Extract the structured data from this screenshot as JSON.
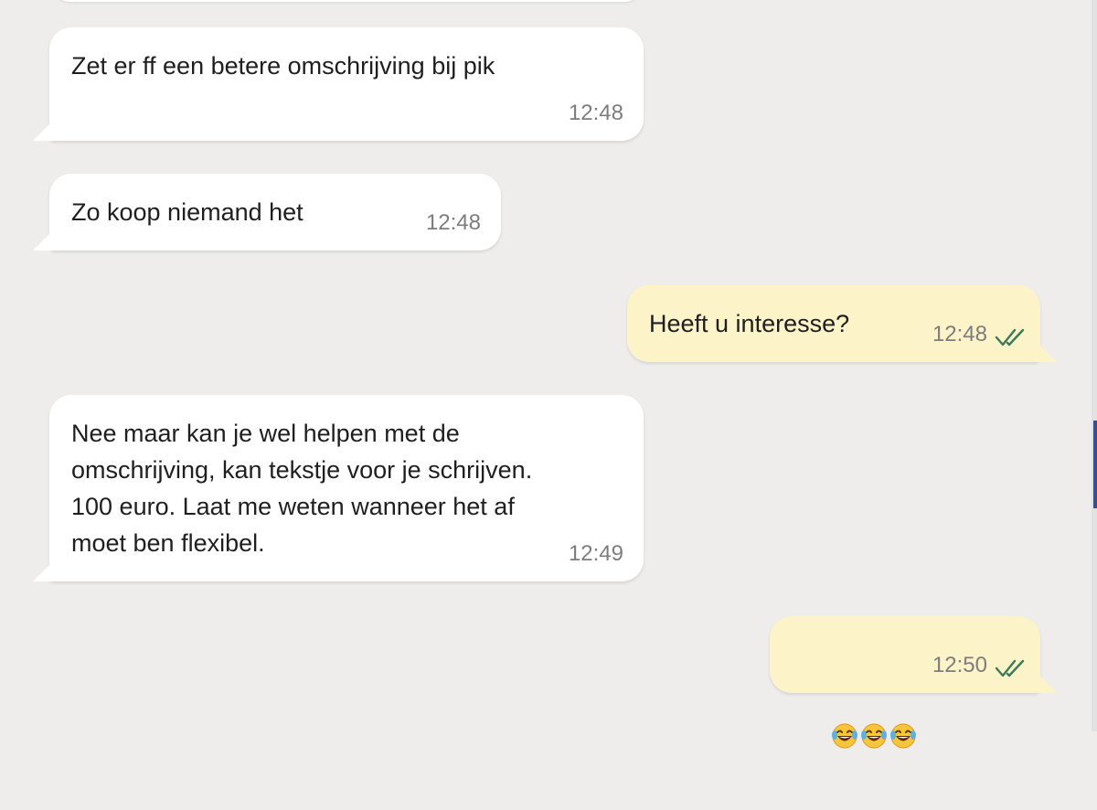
{
  "colors": {
    "background": "#eeedeb",
    "incoming_bubble": "#ffffff",
    "outgoing_bubble": "#fdf3c8",
    "read_ticks": "#3a7a5a",
    "timestamp": "#7d7d7d"
  },
  "messages": [
    {
      "direction": "incoming",
      "text": "Zet er ff een betere omschrijving bij pik",
      "time": "12:48"
    },
    {
      "direction": "incoming",
      "text": "Zo koop niemand het",
      "time": "12:48"
    },
    {
      "direction": "outgoing",
      "text": "Heeft u interesse?",
      "time": "12:48",
      "status_icon": "double-check-icon"
    },
    {
      "direction": "incoming",
      "text": "Nee maar kan je wel helpen met de\nomschrijving, kan tekstje voor je schrijven.\n100 euro. Laat me weten wanneer het af\nmoet ben flexibel.",
      "time": "12:49"
    },
    {
      "direction": "outgoing",
      "text": "",
      "emoji": [
        "face-with-tears-of-joy-icon",
        "face-with-tears-of-joy-icon",
        "face-with-tears-of-joy-icon"
      ],
      "time": "12:50",
      "status_icon": "double-check-icon"
    }
  ]
}
